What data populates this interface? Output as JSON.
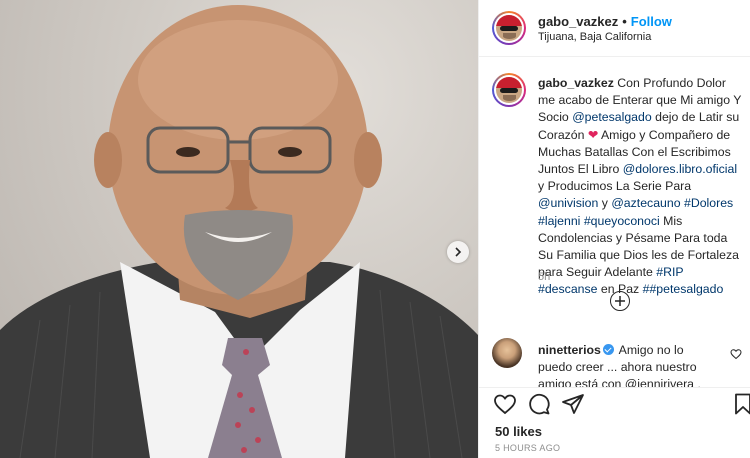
{
  "post": {
    "username": "gabo_vazkez",
    "separator": "•",
    "follow_label": "Follow",
    "location": "Tijuana, Baja California"
  },
  "caption": {
    "username": "gabo_vazkez",
    "t1": " Con Profundo Dolor me acabo de Enterar que Mi amigo Y Socio ",
    "m_petesalgado": "@petesalgado",
    "t2": " dejo de Latir su Corazón ",
    "heart": "❤",
    "t3": " Amigo y Compañero de Muchas Batallas Con el Escribimos Juntos El Libro ",
    "m_dolores": "@dolores.libro.oficial",
    "t4": " y Producimos La Serie Para ",
    "m_univision": "@univision",
    "t5": " y ",
    "m_aztecauno": "@aztecauno",
    "t6": " ",
    "h_dolores": "#Dolores",
    "t7": " ",
    "h_lajenni": "#lajenni",
    "t8": " ",
    "h_queyoconoci": "#queyoconoci",
    "t9": " Mis Condolencias y Pésame Para toda Su Familia que Dios les de Fortaleza para Seguir Adelante ",
    "h_rip": "#RIP",
    "t10": " ",
    "h_descanse": "#descanse",
    "t11": " en Paz ",
    "h_petesalgado": "##petesalgado",
    "time": "5h"
  },
  "comment": {
    "username": "ninetterios",
    "text": " Amigo no lo puedo creer ... ahora nuestro amigo está con @jennirivera , Arturo y Jacob"
  },
  "actions": {
    "icons": [
      "heart-icon",
      "comment-icon",
      "share-icon",
      "bookmark-icon"
    ],
    "likes": "50 likes",
    "ago": "5 HOURS AGO"
  },
  "colors": {
    "link": "#00376b",
    "follow": "#0095f6",
    "heart": "#e0245e",
    "muted": "#8e8e8e"
  }
}
